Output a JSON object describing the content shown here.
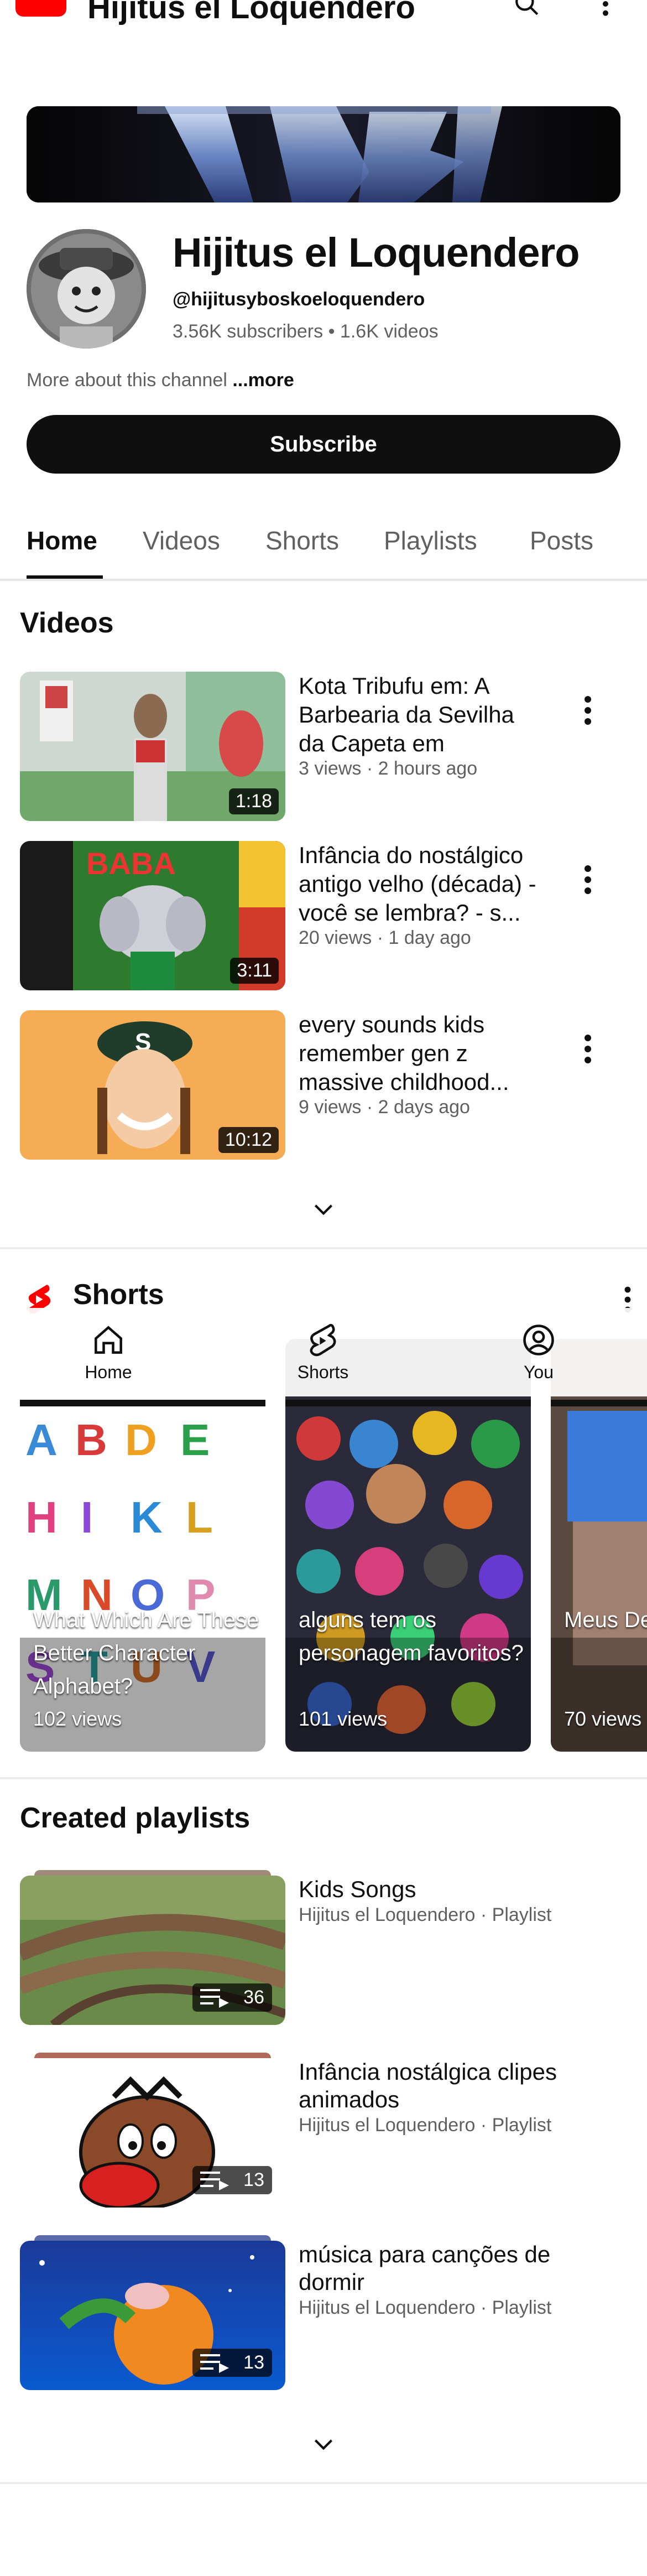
{
  "topbar": {
    "title": "Hijitus el Loquendero"
  },
  "channel": {
    "name": "Hijitus el Loquendero",
    "handle": "@hijitusyboskoeloquendero",
    "stats": "3.56K subscribers • 1.6K videos",
    "about_text": "More about this channel ",
    "about_more": "...more",
    "subscribe_label": "Subscribe"
  },
  "tabs": [
    "Home",
    "Videos",
    "Shorts",
    "Playlists",
    "Posts"
  ],
  "videos_section": {
    "title": "Videos",
    "items": [
      {
        "title": "Kota Tribufu em: A Barbearia da Sevilha da Capeta em Forma...",
        "meta": "3 views · 2 hours ago",
        "duration": "1:18"
      },
      {
        "title": "Infância do nostálgico antigo velho (década) - você se lembra? - s...",
        "meta": "20 views · 1 day ago",
        "duration": "3:11"
      },
      {
        "title": "every sounds kids remember gen z massive childhood...",
        "meta": "9 views · 2 days ago",
        "duration": "10:12"
      }
    ]
  },
  "shorts_section": {
    "title": "Shorts",
    "items": [
      {
        "title": "What Which Are These Better Character Alphabet?",
        "views": "102 views"
      },
      {
        "title": "alguns tem os personagem favoritos?",
        "views": "101 views"
      },
      {
        "title": "Meus De Predileto Drongo,",
        "views": "70 views"
      }
    ]
  },
  "bottom_nav": {
    "home": "Home",
    "shorts": "Shorts",
    "you": "You"
  },
  "playlists_section": {
    "title": "Created playlists",
    "items": [
      {
        "title": "Kids Songs",
        "meta": "Hijitus el Loquendero · Playlist",
        "count": "36"
      },
      {
        "title": "Infância nostálgica clipes animados",
        "meta": "Hijitus el Loquendero · Playlist",
        "count": "13"
      },
      {
        "title": "música para canções de dormir",
        "meta": "Hijitus el Loquendero · Playlist",
        "count": "13"
      }
    ]
  },
  "icons": {
    "logo": "youtube-logo",
    "search": "search-icon",
    "more": "more-vert-icon",
    "expand": "chevron-down-icon",
    "shorts": "shorts-icon",
    "home": "home-icon",
    "you": "account-circle-icon",
    "playlist": "playlist-icon"
  },
  "colors": {
    "brand_red": "#ff0000",
    "text_primary": "#0f0f0f",
    "text_secondary": "#606060"
  }
}
